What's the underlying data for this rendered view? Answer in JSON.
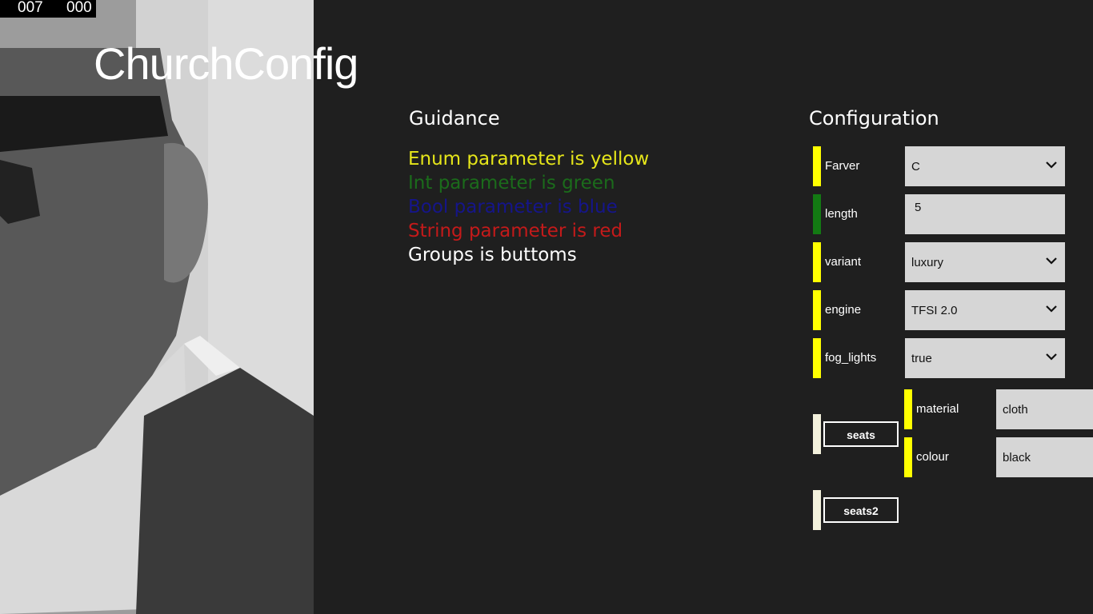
{
  "counter": {
    "left": "007",
    "right": "000"
  },
  "app": {
    "title": "ChurchConfig"
  },
  "guidance": {
    "title": "Guidance",
    "items": [
      {
        "text": "Enum parameter is yellow",
        "color": "#e6e61a"
      },
      {
        "text": "Int parameter is green",
        "color": "#1b6b1b"
      },
      {
        "text": "Bool parameter is blue",
        "color": "#15158a"
      },
      {
        "text": "String parameter is red",
        "color": "#c41a1a"
      },
      {
        "text": "Groups is buttoms",
        "color": "#ffffff"
      }
    ]
  },
  "configuration": {
    "title": "Configuration",
    "params": [
      {
        "label": "Farver",
        "value": "C",
        "kind": "enum",
        "color": "#ffff00"
      },
      {
        "label": "length",
        "value": "5",
        "kind": "int",
        "color": "#137a13"
      },
      {
        "label": "variant",
        "value": "luxury",
        "kind": "enum",
        "color": "#ffff00"
      },
      {
        "label": "engine",
        "value": "TFSI 2.0",
        "kind": "enum",
        "color": "#ffff00"
      },
      {
        "label": "fog_lights",
        "value": "true",
        "kind": "enum",
        "color": "#ffff00"
      }
    ],
    "groups": [
      {
        "label": "seats",
        "color": "#f3f1dc",
        "params": [
          {
            "label": "material",
            "value": "cloth",
            "color": "#ffff00"
          },
          {
            "label": "colour",
            "value": "black",
            "color": "#ffff00"
          }
        ]
      },
      {
        "label": "seats2",
        "color": "#f3f1dc"
      }
    ]
  }
}
